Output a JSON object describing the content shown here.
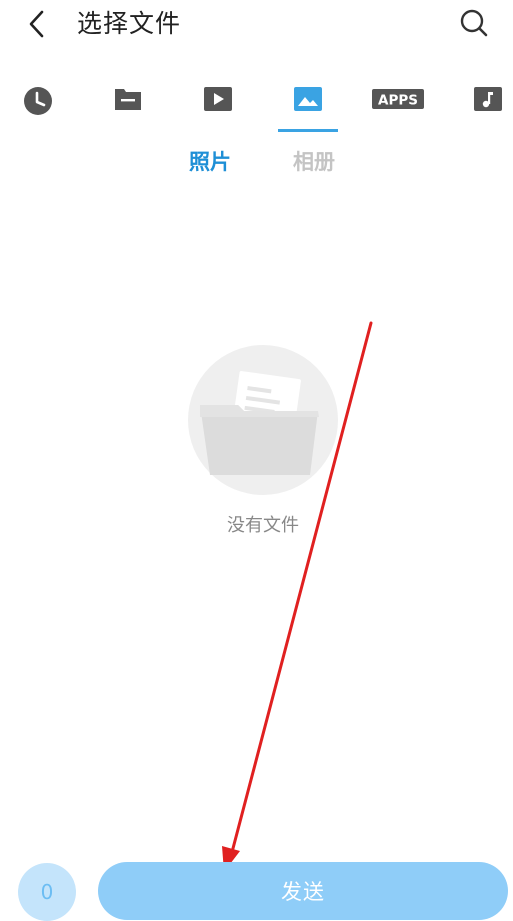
{
  "header": {
    "title": "选择文件",
    "back_icon": "chevron-left-icon",
    "search_icon": "search-icon"
  },
  "category_tabs": [
    {
      "id": "recent",
      "icon": "clock-icon",
      "selected": false
    },
    {
      "id": "folder",
      "icon": "folder-icon",
      "selected": false
    },
    {
      "id": "video",
      "icon": "play-icon",
      "selected": false
    },
    {
      "id": "image",
      "icon": "image-icon",
      "selected": true
    },
    {
      "id": "apps",
      "icon": "apps-icon",
      "label": "APPS",
      "selected": false
    },
    {
      "id": "music",
      "icon": "music-note-icon",
      "selected": false
    }
  ],
  "sub_tabs": [
    {
      "label": "照片",
      "active": true
    },
    {
      "label": "相册",
      "active": false
    }
  ],
  "empty_state": {
    "icon": "empty-folder-icon",
    "text": "没有文件"
  },
  "bottom_bar": {
    "selected_count": "0",
    "send_label": "发送"
  },
  "colors": {
    "accent": "#1e8fd6",
    "tab_icon": "#555555",
    "send_button": "#8fcdf8",
    "annotation_arrow": "#e02020"
  }
}
